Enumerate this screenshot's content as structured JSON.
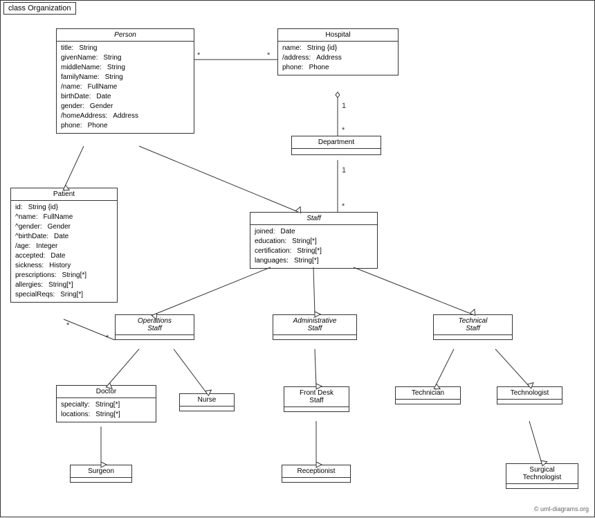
{
  "diagram": {
    "title": "class Organization",
    "copyright": "© uml-diagrams.org",
    "classes": {
      "person": {
        "name": "Person",
        "italic": true,
        "attrs": [
          [
            "title:",
            "String"
          ],
          [
            "givenName:",
            "String"
          ],
          [
            "middleName:",
            "String"
          ],
          [
            "familyName:",
            "String"
          ],
          [
            "/name:",
            "FullName"
          ],
          [
            "birthDate:",
            "Date"
          ],
          [
            "gender:",
            "Gender"
          ],
          [
            "/homeAddress:",
            "Address"
          ],
          [
            "phone:",
            "Phone"
          ]
        ]
      },
      "hospital": {
        "name": "Hospital",
        "italic": false,
        "attrs": [
          [
            "name:",
            "String {id}"
          ],
          [
            "/address:",
            "Address"
          ],
          [
            "phone:",
            "Phone"
          ]
        ]
      },
      "department": {
        "name": "Department",
        "italic": false,
        "attrs": []
      },
      "staff": {
        "name": "Staff",
        "italic": true,
        "attrs": [
          [
            "joined:",
            "Date"
          ],
          [
            "education:",
            "String[*]"
          ],
          [
            "certification:",
            "String[*]"
          ],
          [
            "languages:",
            "String[*]"
          ]
        ]
      },
      "patient": {
        "name": "Patient",
        "italic": false,
        "attrs": [
          [
            "id:",
            "String {id}"
          ],
          [
            "^name:",
            "FullName"
          ],
          [
            "^gender:",
            "Gender"
          ],
          [
            "^birthDate:",
            "Date"
          ],
          [
            "/age:",
            "Integer"
          ],
          [
            "accepted:",
            "Date"
          ],
          [
            "sickness:",
            "History"
          ],
          [
            "prescriptions:",
            "String[*]"
          ],
          [
            "allergies:",
            "String[*]"
          ],
          [
            "specialReqs:",
            "Sring[*]"
          ]
        ]
      },
      "operations_staff": {
        "name": "Operations Staff",
        "italic": true,
        "attrs": []
      },
      "administrative_staff": {
        "name": "Administrative Staff",
        "italic": true,
        "attrs": []
      },
      "technical_staff": {
        "name": "Technical Staff",
        "italic": true,
        "attrs": []
      },
      "doctor": {
        "name": "Doctor",
        "italic": false,
        "attrs": [
          [
            "specialty:",
            "String[*]"
          ],
          [
            "locations:",
            "String[*]"
          ]
        ]
      },
      "nurse": {
        "name": "Nurse",
        "italic": false,
        "attrs": []
      },
      "front_desk_staff": {
        "name": "Front Desk Staff",
        "italic": false,
        "attrs": []
      },
      "technician": {
        "name": "Technician",
        "italic": false,
        "attrs": []
      },
      "technologist": {
        "name": "Technologist",
        "italic": false,
        "attrs": []
      },
      "surgeon": {
        "name": "Surgeon",
        "italic": false,
        "attrs": []
      },
      "receptionist": {
        "name": "Receptionist",
        "italic": false,
        "attrs": []
      },
      "surgical_technologist": {
        "name": "Surgical Technologist",
        "italic": false,
        "attrs": []
      }
    }
  }
}
